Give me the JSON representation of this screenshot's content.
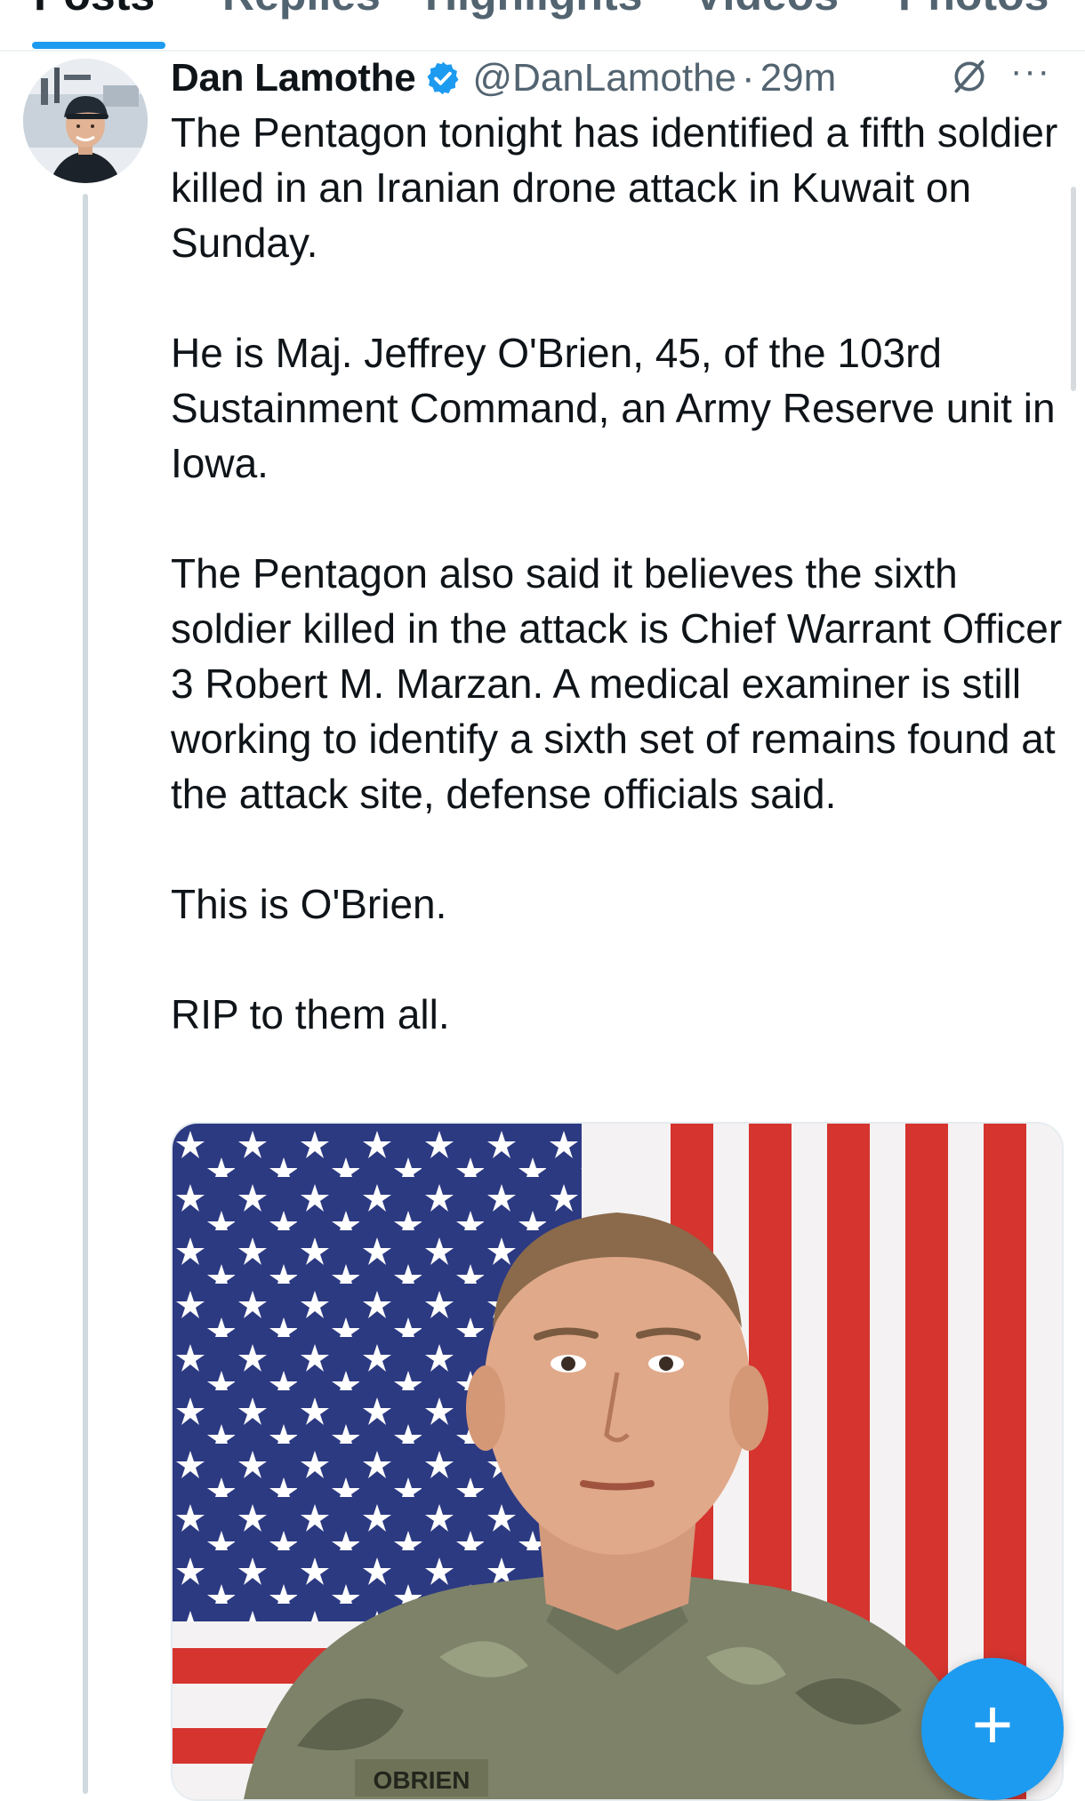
{
  "tabs": [
    {
      "label": "Posts",
      "active": true
    },
    {
      "label": "Replies",
      "active": false
    },
    {
      "label": "Highlights",
      "active": false
    },
    {
      "label": "Videos",
      "active": false
    },
    {
      "label": "Photos",
      "active": false
    }
  ],
  "post": {
    "author": {
      "display_name": "Dan Lamothe",
      "handle": "@DanLamothe",
      "verified": true
    },
    "separator": "·",
    "time": "29m",
    "paragraphs": [
      "The Pentagon tonight has identified a fifth soldier killed in an Iranian drone attack in Kuwait on Sunday.",
      "He is Maj. Jeffrey O'Brien, 45, of the 103rd Sustainment Command, an Army Reserve unit in Iowa.",
      "The Pentagon also said it believes the sixth soldier killed in the attack is Chief Warrant Officer 3 Robert M. Marzan. A medical examiner is still working to identify a sixth set of remains found at the attack site, defense officials said.",
      "This is O'Brien.",
      "RIP to them all."
    ],
    "media": {
      "name_tape": "OBRIEN"
    }
  },
  "icons": {
    "verified": "verified-badge-icon",
    "grok": "grok-icon",
    "more": "more-options-icon",
    "compose": "plus-icon"
  },
  "fab": {
    "label": "+"
  },
  "colors": {
    "accent": "#1d9bf0",
    "text_primary": "#0f1419",
    "text_secondary": "#536471",
    "divider": "#eff3f4"
  }
}
